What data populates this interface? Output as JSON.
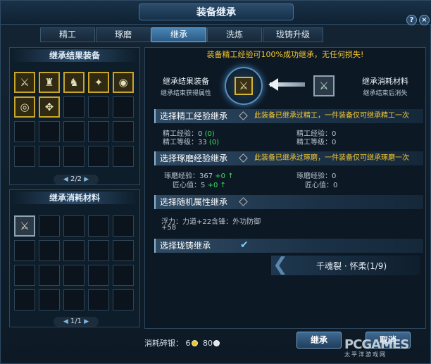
{
  "window": {
    "title": "装备继承",
    "help_label": "?",
    "close_label": "×"
  },
  "tabs": [
    {
      "label": "精工",
      "active": false
    },
    {
      "label": "琢磨",
      "active": false
    },
    {
      "label": "继承",
      "active": true
    },
    {
      "label": "洗炼",
      "active": false
    },
    {
      "label": "珑铸升级",
      "active": false
    }
  ],
  "left": {
    "result_header": "继承结果装备",
    "result_items": [
      {
        "icon": "bracer-icon",
        "glyph": "⚔"
      },
      {
        "icon": "robe-icon",
        "glyph": "♜"
      },
      {
        "icon": "leg-armor-icon",
        "glyph": "♞"
      },
      {
        "icon": "claw-icon",
        "glyph": "✦"
      },
      {
        "icon": "ring-icon",
        "glyph": "◉"
      },
      {
        "icon": "ring-icon",
        "glyph": "◎"
      },
      {
        "icon": "gauntlet-icon",
        "glyph": "✥"
      }
    ],
    "result_pager": "2/2",
    "material_header": "继承消耗材料",
    "material_items": [
      {
        "icon": "gauntlet-icon",
        "glyph": "⚔"
      }
    ],
    "material_pager": "1/1"
  },
  "right": {
    "notice": "装备精工经验可100%成功继承，无任何损失!",
    "result_slot": {
      "title": "继承结果装备",
      "sub": "继承结束获得属性"
    },
    "material_slot": {
      "title": "继承消耗材料",
      "sub": "继承结束后消失"
    },
    "refine": {
      "label": "选择精工经验继承",
      "note": "此装备已继承过精工，一件装备仅可继承精工一次",
      "left_rows": [
        {
          "k": "精工经验：",
          "v": "0",
          "g": "(0)"
        },
        {
          "k": "精工等级：",
          "v": "33",
          "g": "(0)"
        }
      ],
      "right_rows": [
        {
          "k": "精工经验：",
          "v": "0"
        },
        {
          "k": "精工等级：",
          "v": "0"
        }
      ]
    },
    "polish": {
      "label": "选择琢磨经验继承",
      "note": "此装备已继承过琢磨，一件装备仅可继承琢磨一次",
      "left_rows": [
        {
          "k": "琢磨经验：",
          "v": "367",
          "g": "+0",
          "arrow": "↑"
        },
        {
          "k": "匠心值：",
          "v": "5",
          "g": "+0",
          "arrow": "↑"
        }
      ],
      "right_rows": [
        {
          "k": "琢磨经验：",
          "v": "0"
        },
        {
          "k": "匠心值：",
          "v": "0"
        }
      ]
    },
    "random": {
      "label": "选择随机属性继承",
      "line1": "浮力：力道+22含锋：外功防御",
      "line2": "+58"
    },
    "casting": {
      "label": "选择珑铸继承",
      "value": "千魂裂 · 怀柔(1/9)"
    },
    "cost_label": "消耗碎银：",
    "cost_gold": "6",
    "cost_silver": "80",
    "inherit_button": "继承",
    "cancel_button": "取消"
  },
  "watermark": {
    "brand": "PCGAMES",
    "sub": "太平洋游戏网"
  },
  "colors": {
    "accent": "#f5c832",
    "green": "#3fe05a",
    "tab_active": "#4a85b5"
  }
}
